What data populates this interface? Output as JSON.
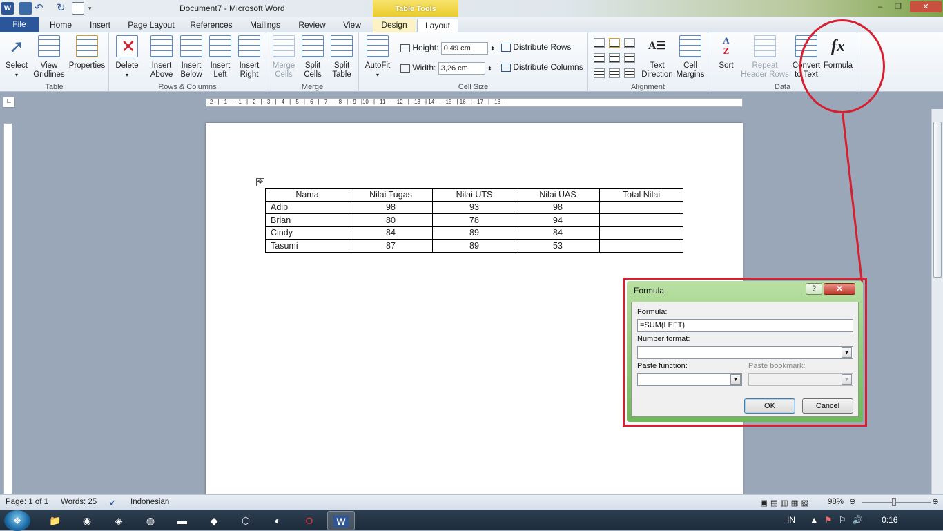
{
  "app": {
    "title": "Document7 - Microsoft Word",
    "context_tab_group": "Table Tools",
    "word_logo": "W",
    "window_controls": {
      "minimize": "–",
      "restore": "❐",
      "close": "✕"
    }
  },
  "tabs": {
    "file": "File",
    "items": [
      "Home",
      "Insert",
      "Page Layout",
      "References",
      "Mailings",
      "Review",
      "View",
      "Design",
      "Layout"
    ],
    "active": "Layout"
  },
  "ribbon": {
    "table": {
      "label": "Table",
      "select": "Select",
      "view_gridlines_1": "View",
      "view_gridlines_2": "Gridlines",
      "properties": "Properties"
    },
    "rows_columns": {
      "label": "Rows & Columns",
      "delete": "Delete",
      "insert_above_1": "Insert",
      "insert_above_2": "Above",
      "insert_below_1": "Insert",
      "insert_below_2": "Below",
      "insert_left_1": "Insert",
      "insert_left_2": "Left",
      "insert_right_1": "Insert",
      "insert_right_2": "Right"
    },
    "merge": {
      "label": "Merge",
      "merge_cells_1": "Merge",
      "merge_cells_2": "Cells",
      "split_cells_1": "Split",
      "split_cells_2": "Cells",
      "split_table_1": "Split",
      "split_table_2": "Table"
    },
    "cell_size": {
      "label": "Cell Size",
      "autofit": "AutoFit",
      "height_label": "Height:",
      "height_value": "0,49 cm",
      "width_label": "Width:",
      "width_value": "3,26 cm",
      "distribute_rows": "Distribute Rows",
      "distribute_columns": "Distribute Columns"
    },
    "alignment": {
      "label": "Alignment",
      "text_direction_1": "Text",
      "text_direction_2": "Direction",
      "cell_margins_1": "Cell",
      "cell_margins_2": "Margins"
    },
    "data": {
      "label": "Data",
      "sort": "Sort",
      "repeat_header_1": "Repeat",
      "repeat_header_2": "Header Rows",
      "convert_1": "Convert",
      "convert_2": "to Text",
      "formula": "Formula",
      "formula_icon_text": "fx"
    }
  },
  "ruler": {
    "marks": "· 2 · | · 1 · | · 1 · | · 2 · | · 3 · | · 4 · | · 5 · | · 6 · | · 7 · | · 8 · | · 9 · |10 · | · 11 · | · 12 · | · 13 · | 14 · | · 15 · | 16 · | · 17 · | · 18 ·"
  },
  "document": {
    "table": {
      "headers": [
        "Nama",
        "Nilai Tugas",
        "Nilai UTS",
        "Nilai UAS",
        "Total Nilai"
      ],
      "rows": [
        [
          "Adip",
          "98",
          "93",
          "98",
          ""
        ],
        [
          "Brian",
          "80",
          "78",
          "94",
          ""
        ],
        [
          "Cindy",
          "84",
          "89",
          "84",
          ""
        ],
        [
          "Tasumi",
          "87",
          "89",
          "53",
          ""
        ]
      ]
    }
  },
  "dialog": {
    "title": "Formula",
    "help": "?",
    "close": "✕",
    "formula_label": "Formula:",
    "formula_value": "=SUM(LEFT)",
    "number_format_label": "Number format:",
    "number_format_value": "",
    "paste_function_label": "Paste function:",
    "paste_bookmark_label": "Paste bookmark:",
    "ok": "OK",
    "cancel": "Cancel"
  },
  "status": {
    "page": "Page: 1 of 1",
    "words": "Words: 25",
    "language": "Indonesian",
    "zoom": "98%"
  },
  "taskbar": {
    "language": "IN",
    "time": "0:16"
  },
  "colors": {
    "accent": "#2b579a",
    "highlight_red": "#d42030",
    "dialog_green": "#6fb65c"
  }
}
